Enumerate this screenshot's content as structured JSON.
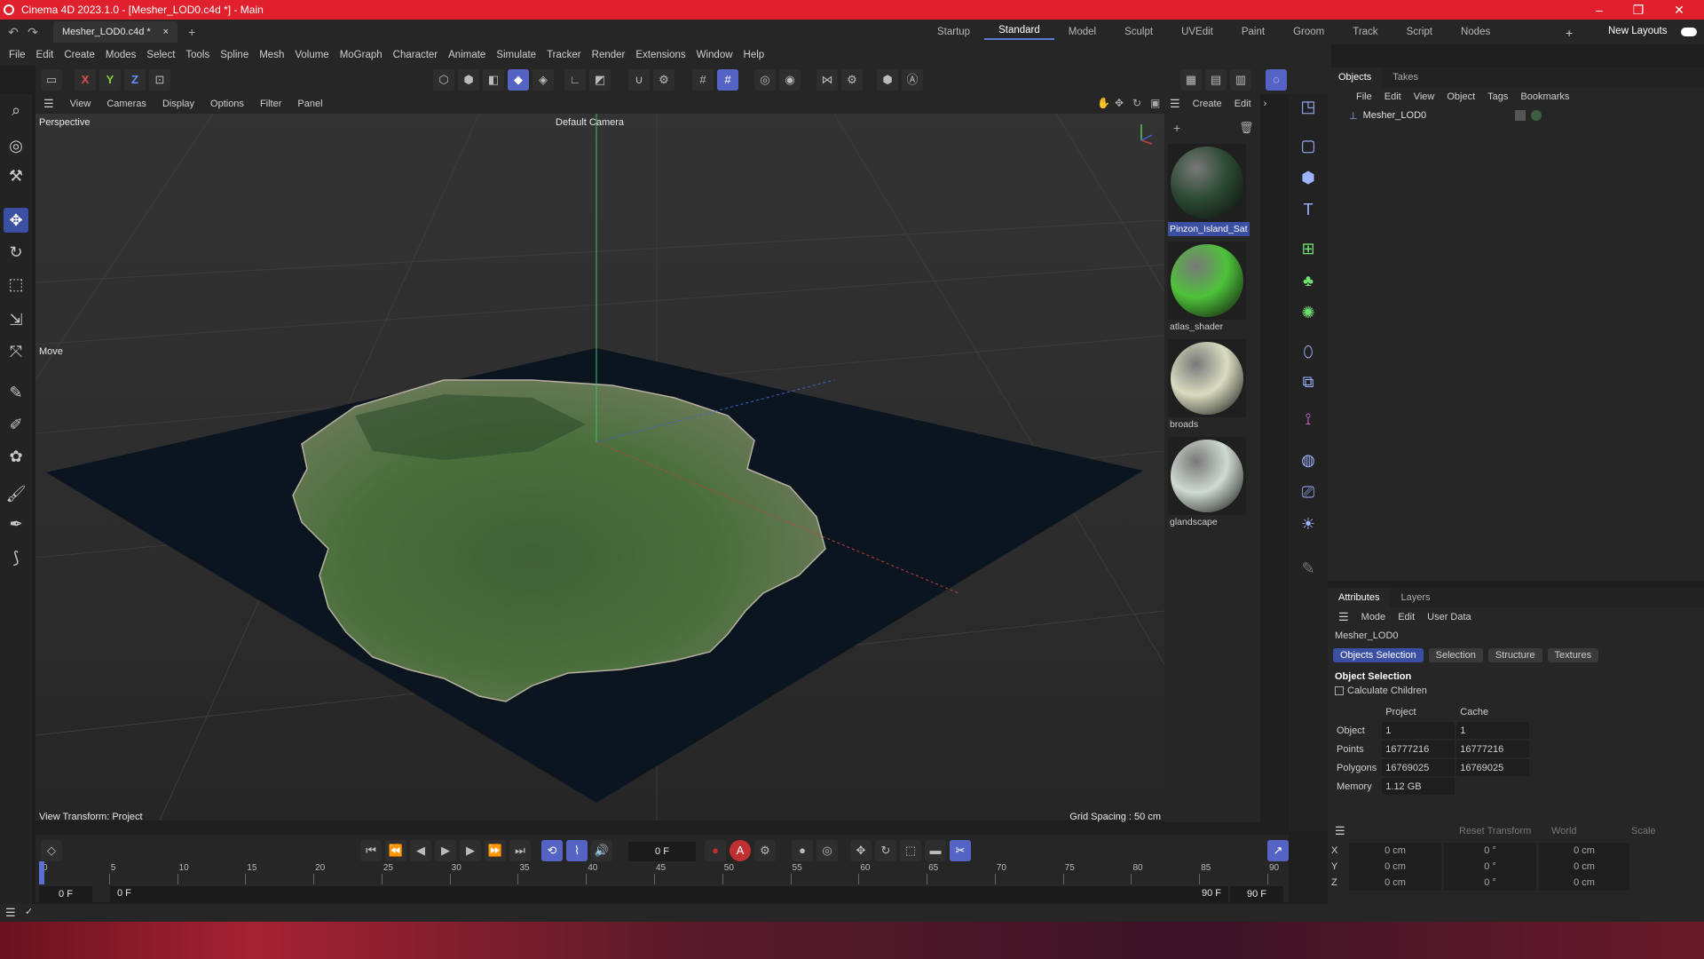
{
  "window": {
    "title": "Cinema 4D 2023.1.0 - [Mesher_LOD0.c4d *] - Main",
    "minimize": "–",
    "restore": "❐",
    "close": "✕"
  },
  "tabs": {
    "doc": "Mesher_LOD0.c4d *",
    "doc_close": "×",
    "add": "+"
  },
  "layouts": {
    "items": [
      "Startup",
      "Standard",
      "Model",
      "Sculpt",
      "UVEdit",
      "Paint",
      "Groom",
      "Track",
      "Script",
      "Nodes"
    ],
    "active": "Standard",
    "add": "+",
    "new_layouts": "New Layouts"
  },
  "menu": [
    "File",
    "Edit",
    "Create",
    "Modes",
    "Select",
    "Tools",
    "Spline",
    "Mesh",
    "Volume",
    "MoGraph",
    "Character",
    "Animate",
    "Simulate",
    "Tracker",
    "Render",
    "Extensions",
    "Window",
    "Help"
  ],
  "axes": {
    "x": "X",
    "y": "Y",
    "z": "Z"
  },
  "viewport": {
    "menu": [
      "View",
      "Cameras",
      "Display",
      "Options",
      "Filter",
      "Panel"
    ],
    "label": "Perspective",
    "camera": "Default Camera",
    "move": "Move",
    "view_transform": "View Transform: Project",
    "grid_spacing": "Grid Spacing : 50 cm"
  },
  "materials": {
    "menu": [
      "Create",
      "Edit"
    ],
    "items": [
      {
        "name": "Pinzon_Island_Sat",
        "color": "#2c4a34"
      },
      {
        "name": "atlas_shader",
        "color": "#4ec23a"
      },
      {
        "name": "broads",
        "color": "#d9dcc0"
      },
      {
        "name": "glandscape",
        "color": "#cfdad0"
      }
    ]
  },
  "objects": {
    "tabs": [
      "Objects",
      "Takes"
    ],
    "menu": [
      "File",
      "Edit",
      "View",
      "Object",
      "Tags",
      "Bookmarks"
    ],
    "item": "Mesher_LOD0"
  },
  "attributes": {
    "tabs": [
      "Attributes",
      "Layers"
    ],
    "menu": [
      "Mode",
      "Edit",
      "User Data"
    ],
    "name": "Mesher_LOD0",
    "subtabs": [
      "Objects Selection",
      "Selection",
      "Structure",
      "Textures"
    ],
    "section": "Object Selection",
    "calc_children": "Calculate Children",
    "headers": [
      "Project",
      "Cache"
    ],
    "rows": [
      {
        "label": "Object",
        "project": "1",
        "cache": "1"
      },
      {
        "label": "Points",
        "project": "16777216",
        "cache": "16777216"
      },
      {
        "label": "Polygons",
        "project": "16769025",
        "cache": "16769025"
      },
      {
        "label": "Memory",
        "project": "1.12 GB",
        "cache": ""
      }
    ]
  },
  "coords": {
    "reset": "Reset Transform",
    "space": "World",
    "scale": "Scale",
    "rows": [
      {
        "axis": "X",
        "a": "0 cm",
        "b": "0 °",
        "c": "0 cm"
      },
      {
        "axis": "Y",
        "a": "0 cm",
        "b": "0 °",
        "c": "0 cm"
      },
      {
        "axis": "Z",
        "a": "0 cm",
        "b": "0 °",
        "c": "0 cm"
      }
    ]
  },
  "timeline": {
    "frame": "0 F",
    "start": "0 F",
    "start2": "0 F",
    "end": "90 F",
    "end2": "90 F",
    "ticks": [
      "0",
      "5",
      "10",
      "15",
      "20",
      "25",
      "30",
      "35",
      "40",
      "45",
      "50",
      "55",
      "60",
      "65",
      "70",
      "75",
      "80",
      "85",
      "90"
    ]
  }
}
